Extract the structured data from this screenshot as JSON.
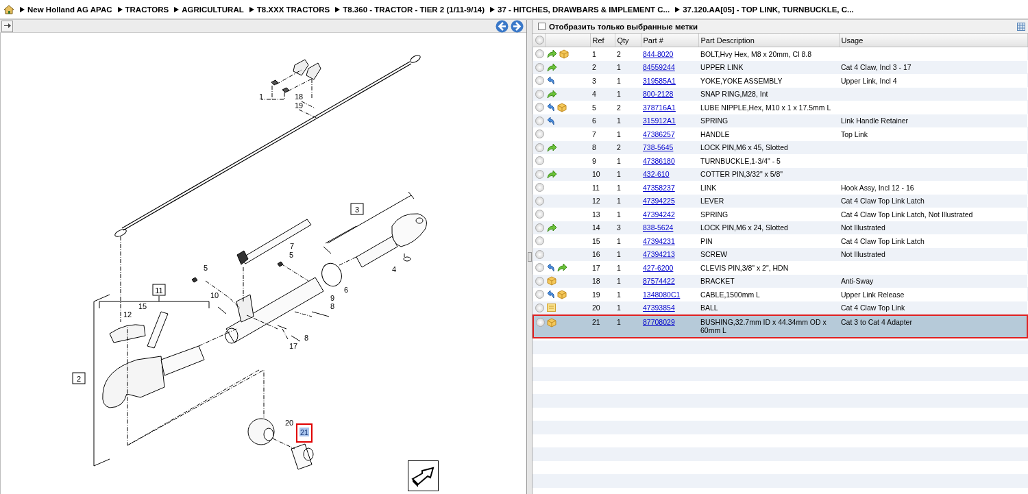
{
  "breadcrumb": [
    "New Holland AG APAC",
    "TRACTORS",
    "AGRICULTURAL",
    "T8.XXX TRACTORS",
    "T8.360 - TRACTOR - TIER 2 (1/11-9/14)",
    "37 - HITCHES, DRAWBARS & IMPLEMENT C...",
    "37.120.AA[05] - TOP LINK, TURNBUCKLE, C..."
  ],
  "diagram": {
    "callouts": [
      {
        "label": "1",
        "boxed": false,
        "selected": false
      },
      {
        "label": "18",
        "boxed": false,
        "selected": false
      },
      {
        "label": "19",
        "boxed": false,
        "selected": false
      },
      {
        "label": "3",
        "boxed": true,
        "selected": false
      },
      {
        "label": "7",
        "boxed": false,
        "selected": false
      },
      {
        "label": "5",
        "boxed": false,
        "selected": false
      },
      {
        "label": "5",
        "boxed": false,
        "selected": false
      },
      {
        "label": "4",
        "boxed": false,
        "selected": false
      },
      {
        "label": "6",
        "boxed": false,
        "selected": false
      },
      {
        "label": "11",
        "boxed": true,
        "selected": false
      },
      {
        "label": "15",
        "boxed": false,
        "selected": false
      },
      {
        "label": "10",
        "boxed": false,
        "selected": false
      },
      {
        "label": "9",
        "boxed": false,
        "selected": false
      },
      {
        "label": "12",
        "boxed": false,
        "selected": false
      },
      {
        "label": "8",
        "boxed": false,
        "selected": false
      },
      {
        "label": "8",
        "boxed": false,
        "selected": false
      },
      {
        "label": "17",
        "boxed": false,
        "selected": false
      },
      {
        "label": "2",
        "boxed": true,
        "selected": false
      },
      {
        "label": "20",
        "boxed": false,
        "selected": false
      },
      {
        "label": "21",
        "boxed": false,
        "selected": true
      }
    ]
  },
  "filter": {
    "label": "Отобразить только выбранные метки",
    "checked": false
  },
  "table": {
    "columns": [
      "Ref",
      "Qty",
      "Part #",
      "Part Description",
      "Usage"
    ],
    "rows": [
      {
        "icons": [
          {
            "kind": "arrow-forward"
          },
          {
            "kind": "box"
          }
        ],
        "ref": "1",
        "qty": "2",
        "part": "844-8020",
        "description": "BOLT,Hvy Hex, M8 x 20mm, Cl 8.8",
        "selected": false
      },
      {
        "icons": [
          {
            "kind": "arrow-forward"
          }
        ],
        "ref": "2",
        "qty": "1",
        "part": "84559244",
        "description": "UPPER LINK",
        "usage": "Cat 4 Claw, Incl 3 - 17",
        "selected": false
      },
      {
        "icons": [
          {
            "kind": "arrow-back"
          }
        ],
        "ref": "3",
        "qty": "1",
        "part": "319585A1",
        "description": "YOKE,YOKE ASSEMBLY",
        "usage": "Upper Link, Incl 4",
        "selected": false
      },
      {
        "icons": [
          {
            "kind": "arrow-forward"
          }
        ],
        "ref": "4",
        "qty": "1",
        "part": "800-2128",
        "description": "SNAP RING,M28, Int",
        "selected": false
      },
      {
        "icons": [
          {
            "kind": "arrow-back"
          },
          {
            "kind": "box"
          }
        ],
        "ref": "5",
        "qty": "2",
        "part": "378716A1",
        "description": "LUBE NIPPLE,Hex, M10 x 1 x 17.5mm L",
        "selected": false
      },
      {
        "icons": [
          {
            "kind": "arrow-back"
          }
        ],
        "ref": "6",
        "qty": "1",
        "part": "315912A1",
        "description": "SPRING",
        "usage": "Link Handle Retainer",
        "selected": false
      },
      {
        "icons": [],
        "ref": "7",
        "qty": "1",
        "part": "47386257",
        "description": "HANDLE",
        "usage": "Top Link",
        "selected": false
      },
      {
        "icons": [
          {
            "kind": "arrow-forward"
          }
        ],
        "ref": "8",
        "qty": "2",
        "part": "738-5645",
        "description": "LOCK PIN,M6 x 45, Slotted",
        "selected": false
      },
      {
        "icons": [],
        "ref": "9",
        "qty": "1",
        "part": "47386180",
        "description": "TURNBUCKLE,1-3/4\" - 5",
        "selected": false
      },
      {
        "icons": [
          {
            "kind": "arrow-forward"
          }
        ],
        "ref": "10",
        "qty": "1",
        "part": "432-610",
        "description": "COTTER PIN,3/32\" x 5/8\"",
        "selected": false
      },
      {
        "icons": [],
        "ref": "11",
        "qty": "1",
        "part": "47358237",
        "description": "LINK",
        "usage": "Hook Assy, Incl 12 - 16",
        "selected": false
      },
      {
        "icons": [],
        "ref": "12",
        "qty": "1",
        "part": "47394225",
        "description": "LEVER",
        "usage": "Cat 4 Claw Top Link Latch",
        "selected": false
      },
      {
        "icons": [],
        "ref": "13",
        "qty": "1",
        "part": "47394242",
        "description": "SPRING",
        "usage": "Cat 4 Claw Top Link Latch, Not Illustrated",
        "selected": false
      },
      {
        "icons": [
          {
            "kind": "arrow-forward"
          }
        ],
        "ref": "14",
        "qty": "3",
        "part": "838-5624",
        "description": "LOCK PIN,M6 x 24, Slotted",
        "usage": "Not Illustrated",
        "selected": false
      },
      {
        "icons": [],
        "ref": "15",
        "qty": "1",
        "part": "47394231",
        "description": "PIN",
        "usage": "Cat 4 Claw Top Link Latch",
        "selected": false
      },
      {
        "icons": [],
        "ref": "16",
        "qty": "1",
        "part": "47394213",
        "description": "SCREW",
        "usage": "Not Illustrated",
        "selected": false
      },
      {
        "icons": [
          {
            "kind": "arrow-back"
          },
          {
            "kind": "arrow-forward"
          }
        ],
        "ref": "17",
        "qty": "1",
        "part": "427-6200",
        "description": "CLEVIS PIN,3/8\" x 2\", HDN",
        "selected": false
      },
      {
        "icons": [
          {
            "kind": "box"
          }
        ],
        "ref": "18",
        "qty": "1",
        "part": "87574422",
        "description": "BRACKET",
        "usage": "Anti-Sway",
        "selected": false
      },
      {
        "icons": [
          {
            "kind": "arrow-back"
          },
          {
            "kind": "box"
          }
        ],
        "ref": "19",
        "qty": "1",
        "part": "1348080C1",
        "description": "CABLE,1500mm L",
        "usage": "Upper Link Release",
        "selected": false
      },
      {
        "icons": [
          {
            "kind": "sheet"
          }
        ],
        "ref": "20",
        "qty": "1",
        "part": "47393854",
        "description": "BALL",
        "usage": "Cat 4 Claw Top Link",
        "selected": false
      },
      {
        "icons": [
          {
            "kind": "box"
          }
        ],
        "ref": "21",
        "qty": "1",
        "part": "87708029",
        "description": "BUSHING,32.7mm ID x 44.34mm OD x 60mm L",
        "usage": "Cat 3 to Cat 4 Adapter",
        "selected": true
      }
    ]
  }
}
